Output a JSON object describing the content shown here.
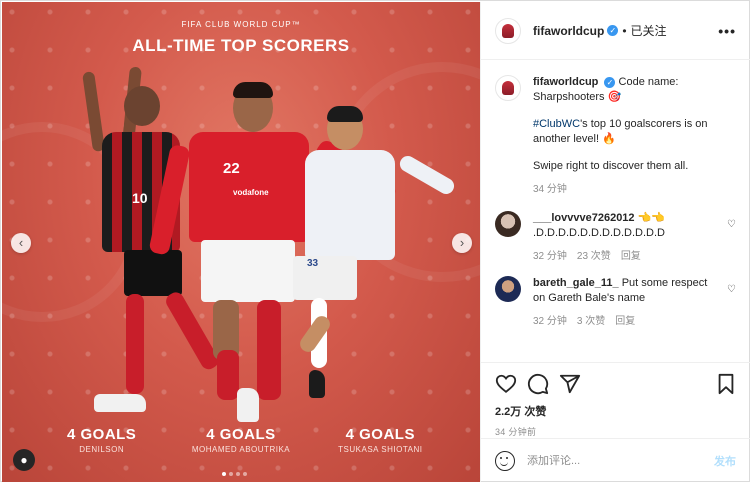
{
  "post": {
    "caption_top": "FIFA CLUB WORLD CUP™",
    "headline": "ALL-TIME TOP SCORERS",
    "scorers": [
      {
        "goals": "4 GOALS",
        "name": "DENILSON",
        "number": "10"
      },
      {
        "goals": "4 GOALS",
        "name": "MOHAMED ABOUTRIKA",
        "number": "22"
      },
      {
        "goals": "4 GOALS",
        "name": "TSUKASA SHIOTANI",
        "number": "33"
      }
    ],
    "sponsor": "vodafone"
  },
  "header": {
    "username": "fifaworldcup",
    "separator": "•",
    "follow_state": "已关注",
    "more": "•••"
  },
  "caption": {
    "username": "fifaworldcup",
    "line1": "Code name: Sharpshooters 🎯",
    "hashtag": "#ClubWC",
    "line2_rest": "'s top 10 goalscorers is on another level! 🔥",
    "line3": "Swipe right to discover them all.",
    "time": "34 分钟"
  },
  "comments": [
    {
      "username": "___lovvvve7262012",
      "text": "👈👈 .D.D.D.D.D.D.D.D.D.D.D.D",
      "time": "32 分钟",
      "likes": "23 次赞",
      "reply": "回复"
    },
    {
      "username": "bareth_gale_11_",
      "text": "Put some respect on Gareth Bale's name",
      "time": "32 分钟",
      "likes": "3 次赞",
      "reply": "回复"
    }
  ],
  "footer": {
    "likes": "2.2万 次赞",
    "posted": "34 分钟前",
    "comment_placeholder": "添加评论...",
    "post_label": "发布"
  },
  "icons": [
    "heart-icon",
    "comment-icon",
    "share-icon",
    "bookmark-icon",
    "emoji-icon",
    "chevron-left-icon",
    "chevron-right-icon",
    "user-tag-icon",
    "more-icon",
    "verified-icon"
  ],
  "colors": {
    "accent": "#3897f0",
    "hashtag": "#00376b",
    "media_bg": "#d35a4c",
    "muted": "#8e8e8e"
  }
}
